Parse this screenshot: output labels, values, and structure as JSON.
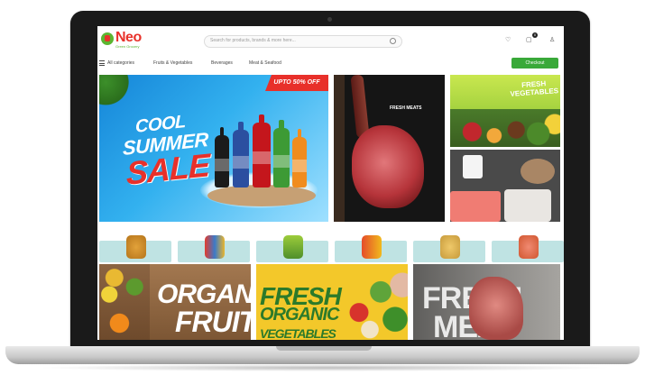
{
  "brand": {
    "name": "Neo",
    "tagline": "Green Grocery"
  },
  "search": {
    "placeholder": "Search for products, brands & more here..."
  },
  "header": {
    "cart_count": "0"
  },
  "nav": {
    "all_categories": "All categories",
    "items": [
      "Fruits & Vegetables",
      "Beverages",
      "Meat & Seafood"
    ],
    "checkout": "Checkout"
  },
  "banners": {
    "sale": {
      "tag": "UPTO 50% OFF",
      "line1": "COOL",
      "line2": "SUMMER",
      "line3": "SALE"
    },
    "meat": {
      "title": "FRESH MEATS"
    },
    "veg": {
      "title": "FRESH VEGETABLES"
    }
  },
  "promos": {
    "fruits": {
      "line1": "ORGANIC",
      "line2": "FRUITS"
    },
    "fresh": {
      "line1": "FRESH",
      "line2": "ORGANIC",
      "line3": "VEGETABLES"
    },
    "meat": {
      "line1": "FRESH",
      "line2": "MEAT"
    }
  },
  "colors": {
    "accent_red": "#e8302a",
    "accent_green": "#39a939",
    "category_bg": "#bfe3e3"
  }
}
